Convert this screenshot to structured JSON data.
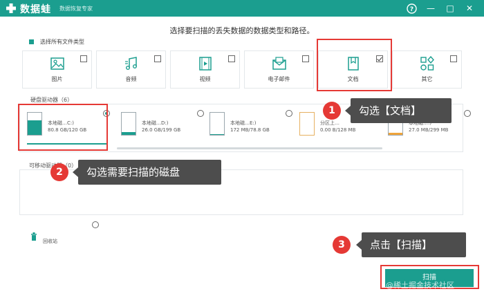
{
  "titlebar": {
    "brand": "数据蛙",
    "subtitle": "数据恢复专家",
    "help_glyph": "?",
    "min_glyph": "—",
    "max_glyph": "□",
    "close_glyph": "✕"
  },
  "instruction": "选择要扫描的丢失数据的数据类型和路径。",
  "select_all": {
    "label": "选择所有文件类型",
    "checked": true
  },
  "file_types": [
    {
      "label": "图片",
      "icon": "image-icon",
      "checked": false
    },
    {
      "label": "音频",
      "icon": "music-icon",
      "checked": false
    },
    {
      "label": "视频",
      "icon": "video-icon",
      "checked": false
    },
    {
      "label": "电子邮件",
      "icon": "email-icon",
      "checked": false
    },
    {
      "label": "文档",
      "icon": "document-icon",
      "checked": true
    },
    {
      "label": "其它",
      "icon": "other-icon",
      "checked": false
    }
  ],
  "drives_section": {
    "label": "硬盘驱动器（6）",
    "drives": [
      {
        "name": "本地磁…C:)",
        "size": "80.8 GB/120 GB",
        "used_fraction": 0.67,
        "selected": true,
        "kind": "system"
      },
      {
        "name": "本地磁…D:)",
        "size": "26.0 GB/199 GB",
        "used_fraction": 0.13,
        "selected": false,
        "kind": "disk"
      },
      {
        "name": "本地磁…E:)",
        "size": "172 MB/78.8 GB",
        "used_fraction": 0.02,
        "selected": false,
        "kind": "disk"
      },
      {
        "name": "分区上…",
        "size": "0.00 B/128 MB",
        "used_fraction": 0.0,
        "selected": false,
        "kind": "partition"
      },
      {
        "name": "本地磁…:)",
        "size": "27.0 MB/299 MB",
        "used_fraction": 0.09,
        "selected": false,
        "kind": "disk"
      }
    ]
  },
  "removable_section": {
    "label": "可移动驱动器（0）"
  },
  "recycle_bin": {
    "label": "回收站"
  },
  "scan_button": {
    "label": "扫描"
  },
  "annotations": [
    {
      "number": "1",
      "text": "勾选【文档】"
    },
    {
      "number": "2",
      "text": "勾选需要扫描的磁盘"
    },
    {
      "number": "3",
      "text": "点击【扫描】"
    }
  ],
  "watermark": "@稀土掘金技术社区",
  "colors": {
    "accent": "#1b9e8f",
    "highlight": "#e53935",
    "callout": "#4d4d4d",
    "partition": "#f0a43a"
  }
}
